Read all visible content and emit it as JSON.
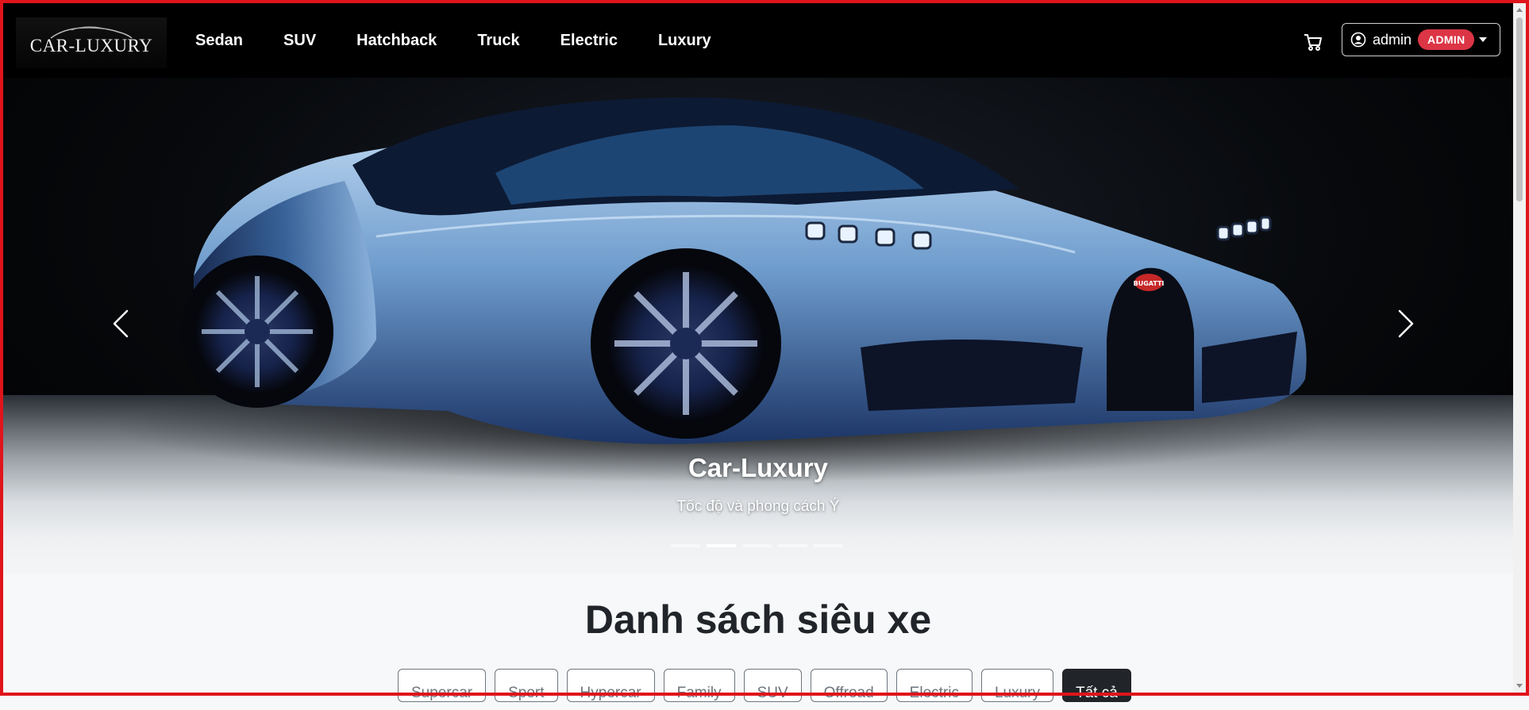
{
  "navbar": {
    "logo_text": "CAR-LUXURY",
    "links": [
      "Sedan",
      "SUV",
      "Hatchback",
      "Truck",
      "Electric",
      "Luxury"
    ],
    "cart_icon": "cart-icon",
    "user": {
      "name": "admin",
      "role_badge": "ADMIN",
      "icon": "user-circle-icon"
    }
  },
  "carousel": {
    "caption_title": "Car-Luxury",
    "caption_subtitle": "Tốc độ và phong cách Ý",
    "indicator_count": 5,
    "active_index": 1,
    "car_badge": "BUGATTI"
  },
  "section": {
    "title": "Danh sách siêu xe",
    "filters": [
      "Supercar",
      "Sport",
      "Hypercar",
      "Family",
      "SUV",
      "Offroad",
      "Electric",
      "Luxury",
      "Tất cả"
    ],
    "active_filter": "Tất cả"
  },
  "colors": {
    "navbar_bg": "#000000",
    "badge_red": "#dc3545",
    "active_filter_bg": "#212529",
    "frame_red": "#e0141b"
  }
}
